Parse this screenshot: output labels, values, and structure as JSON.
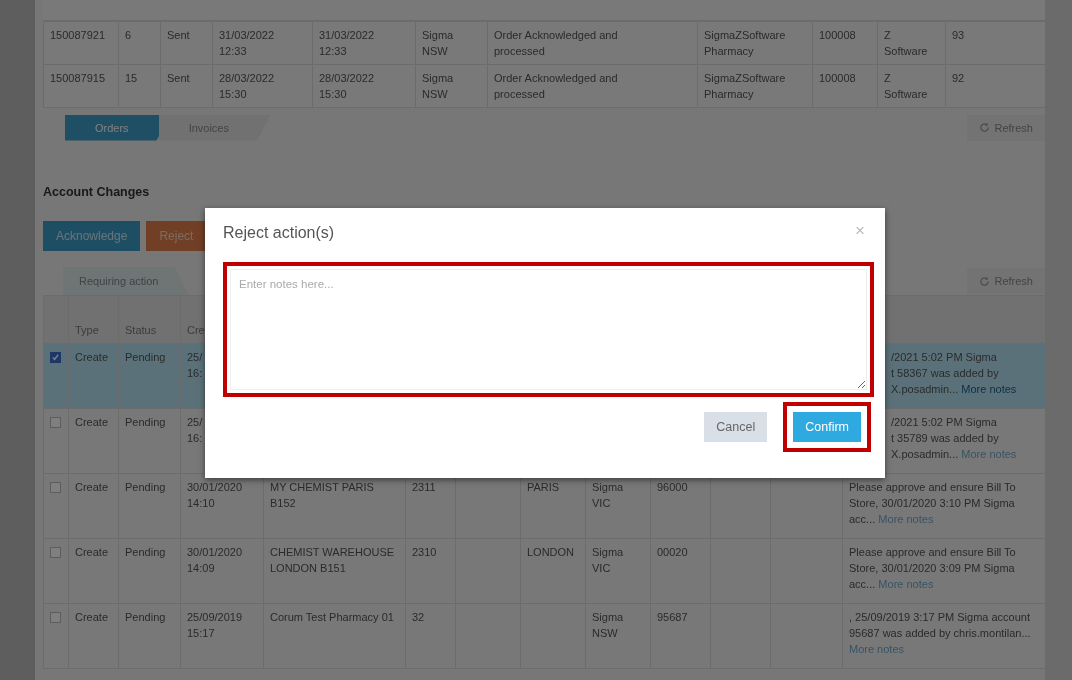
{
  "orders_table": {
    "rows": [
      {
        "cells": [
          "150087921",
          "6",
          "Sent",
          "31/03/2022 12:33",
          "31/03/2022 12:33",
          "Sigma NSW",
          "Order Acknowledged and processed",
          "SigmaZSoftware Pharmacy",
          "100008",
          "Z Software",
          "93"
        ]
      },
      {
        "cells": [
          "150087915",
          "15",
          "Sent",
          "28/03/2022 15:30",
          "28/03/2022 15:30",
          "Sigma NSW",
          "Order Acknowledged and processed",
          "SigmaZSoftware Pharmacy",
          "100008",
          "Z Software",
          "92"
        ]
      }
    ]
  },
  "order_tabs": [
    {
      "label": "Orders",
      "selected": true
    },
    {
      "label": "Invoices",
      "selected": false
    }
  ],
  "orders_refresh": "Refresh",
  "section_title": "Account Changes",
  "actions": [
    {
      "label": "Acknowledge",
      "kind": "primary"
    },
    {
      "label": "Reject",
      "kind": "danger"
    }
  ],
  "account_tabs": [
    {
      "label": "Requiring action",
      "selected": true
    }
  ],
  "account_refresh": "Refresh",
  "account_table": {
    "columns": [
      "Type",
      "Status",
      "Cre"
    ],
    "rows": [
      {
        "kind": "under-dialog",
        "selected": true,
        "checked": true,
        "type": "Create",
        "status": "Pending",
        "created": "25/ 16:",
        "notes": [
          "/2021 5:02 PM Sigma",
          "t 58367 was added by",
          "X.posadmin..."
        ],
        "more": "More notes"
      },
      {
        "kind": "under-dialog",
        "selected": false,
        "checked": false,
        "type": "Create",
        "status": "Pending",
        "created": "25/ 16:",
        "notes": [
          "/2021 5:02 PM Sigma",
          "t 35789 was added by",
          "X.posadmin..."
        ],
        "more": "More notes"
      },
      {
        "kind": "full",
        "selected": false,
        "checked": false,
        "type": "Create",
        "status": "Pending",
        "created": "30/01/2020 14:10",
        "name": "MY CHEMIST PARIS B152",
        "number": "2311",
        "city": "PARIS",
        "region": "Sigma VIC",
        "code": "96000",
        "notes": "Please approve and ensure Bill To Store, 30/01/2020 3:10 PM Sigma acc...",
        "more": "More notes"
      },
      {
        "kind": "full",
        "selected": false,
        "checked": false,
        "type": "Create",
        "status": "Pending",
        "created": "30/01/2020 14:09",
        "name": "CHEMIST WAREHOUSE LONDON B151",
        "number": "2310",
        "city": "LONDON",
        "region": "Sigma VIC",
        "code": "00020",
        "notes": "Please approve and ensure Bill To Store, 30/01/2020 3:09 PM Sigma acc...",
        "more": "More notes"
      },
      {
        "kind": "full",
        "selected": false,
        "checked": false,
        "type": "Create",
        "status": "Pending",
        "created": "25/09/2019 15:17",
        "name": "Corum Test Pharmacy 01",
        "number": "32",
        "region": "Sigma NSW",
        "code": "95687",
        "notes": ", 25/09/2019 3:17 PM Sigma account 95687 was added by chris.montilan...",
        "more": "More notes"
      }
    ]
  },
  "dialog": {
    "title": "Reject action(s)",
    "close": "×",
    "notes_placeholder": "Enter notes here...",
    "notes_highlighted": true,
    "buttons": [
      {
        "label": "Cancel",
        "kind": "secondary",
        "highlighted": false
      },
      {
        "label": "Confirm",
        "kind": "primary",
        "highlighted": true
      }
    ]
  }
}
